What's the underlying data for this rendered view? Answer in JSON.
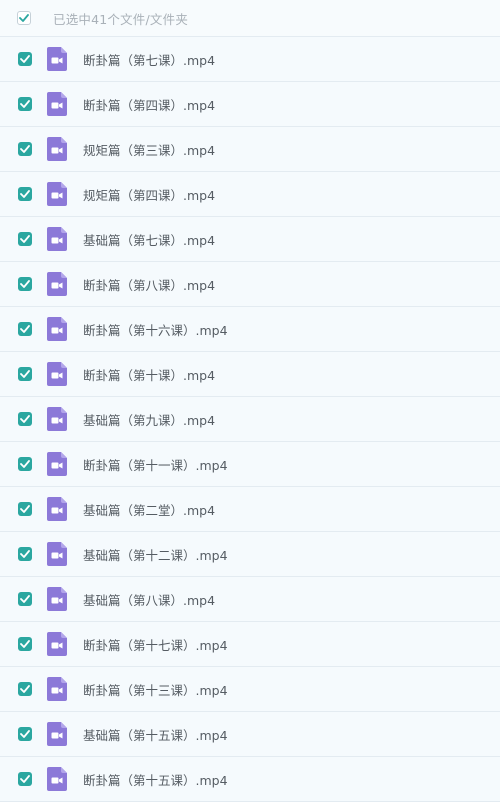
{
  "header": {
    "selection_text": "已选中41个文件/文件夹"
  },
  "icons": {
    "checkbox": "checkbox-checked-icon",
    "file": "video-file-icon"
  },
  "colors": {
    "checkbox_checked": "#2ba7a0",
    "video_icon": "#8c79d8"
  },
  "files": [
    {
      "name": "断卦篇（第七课）.mp4"
    },
    {
      "name": "断卦篇（第四课）.mp4"
    },
    {
      "name": "规矩篇（第三课）.mp4"
    },
    {
      "name": "规矩篇（第四课）.mp4"
    },
    {
      "name": "基础篇（第七课）.mp4"
    },
    {
      "name": "断卦篇（第八课）.mp4"
    },
    {
      "name": "断卦篇（第十六课）.mp4"
    },
    {
      "name": "断卦篇（第十课）.mp4"
    },
    {
      "name": "基础篇（第九课）.mp4"
    },
    {
      "name": "断卦篇（第十一课）.mp4"
    },
    {
      "name": "基础篇（第二堂）.mp4"
    },
    {
      "name": "基础篇（第十二课）.mp4"
    },
    {
      "name": "基础篇（第八课）.mp4"
    },
    {
      "name": "断卦篇（第十七课）.mp4"
    },
    {
      "name": "断卦篇（第十三课）.mp4"
    },
    {
      "name": "基础篇（第十五课）.mp4"
    },
    {
      "name": "断卦篇（第十五课）.mp4"
    }
  ]
}
